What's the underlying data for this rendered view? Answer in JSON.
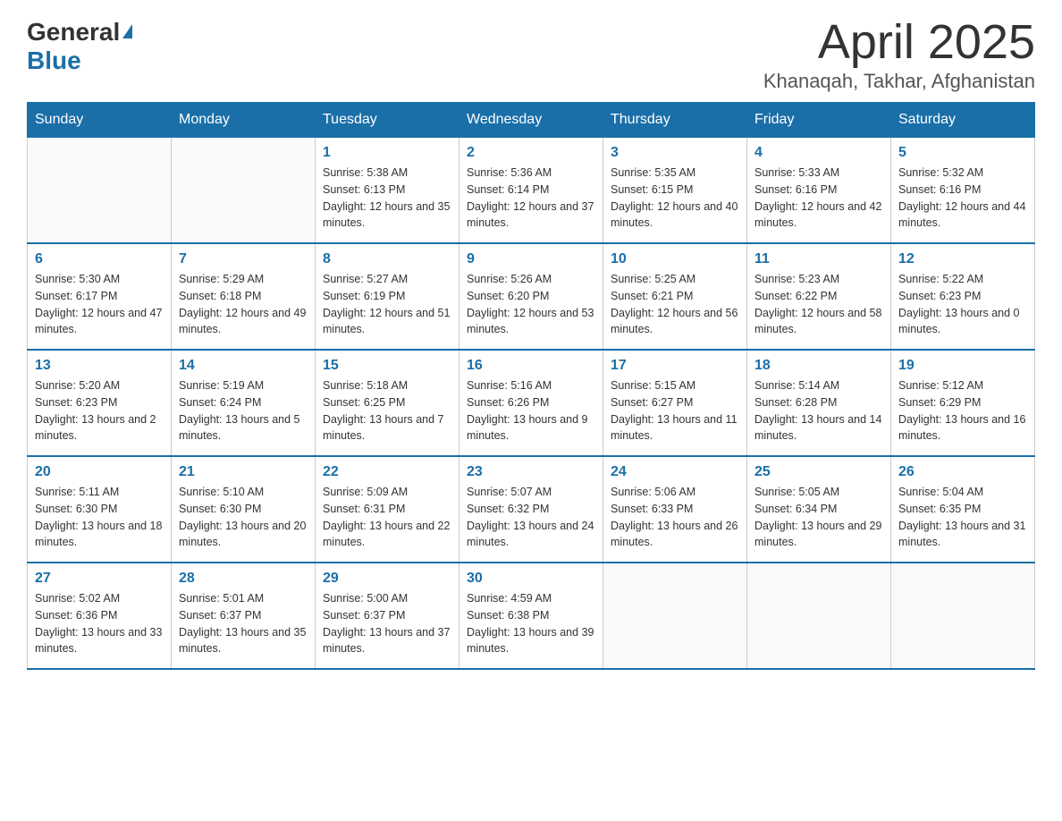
{
  "header": {
    "logo_general": "General",
    "logo_blue": "Blue",
    "title": "April 2025",
    "subtitle": "Khanaqah, Takhar, Afghanistan"
  },
  "days_of_week": [
    "Sunday",
    "Monday",
    "Tuesday",
    "Wednesday",
    "Thursday",
    "Friday",
    "Saturday"
  ],
  "weeks": [
    [
      {
        "day": "",
        "sunrise": "",
        "sunset": "",
        "daylight": ""
      },
      {
        "day": "",
        "sunrise": "",
        "sunset": "",
        "daylight": ""
      },
      {
        "day": "1",
        "sunrise": "Sunrise: 5:38 AM",
        "sunset": "Sunset: 6:13 PM",
        "daylight": "Daylight: 12 hours and 35 minutes."
      },
      {
        "day": "2",
        "sunrise": "Sunrise: 5:36 AM",
        "sunset": "Sunset: 6:14 PM",
        "daylight": "Daylight: 12 hours and 37 minutes."
      },
      {
        "day": "3",
        "sunrise": "Sunrise: 5:35 AM",
        "sunset": "Sunset: 6:15 PM",
        "daylight": "Daylight: 12 hours and 40 minutes."
      },
      {
        "day": "4",
        "sunrise": "Sunrise: 5:33 AM",
        "sunset": "Sunset: 6:16 PM",
        "daylight": "Daylight: 12 hours and 42 minutes."
      },
      {
        "day": "5",
        "sunrise": "Sunrise: 5:32 AM",
        "sunset": "Sunset: 6:16 PM",
        "daylight": "Daylight: 12 hours and 44 minutes."
      }
    ],
    [
      {
        "day": "6",
        "sunrise": "Sunrise: 5:30 AM",
        "sunset": "Sunset: 6:17 PM",
        "daylight": "Daylight: 12 hours and 47 minutes."
      },
      {
        "day": "7",
        "sunrise": "Sunrise: 5:29 AM",
        "sunset": "Sunset: 6:18 PM",
        "daylight": "Daylight: 12 hours and 49 minutes."
      },
      {
        "day": "8",
        "sunrise": "Sunrise: 5:27 AM",
        "sunset": "Sunset: 6:19 PM",
        "daylight": "Daylight: 12 hours and 51 minutes."
      },
      {
        "day": "9",
        "sunrise": "Sunrise: 5:26 AM",
        "sunset": "Sunset: 6:20 PM",
        "daylight": "Daylight: 12 hours and 53 minutes."
      },
      {
        "day": "10",
        "sunrise": "Sunrise: 5:25 AM",
        "sunset": "Sunset: 6:21 PM",
        "daylight": "Daylight: 12 hours and 56 minutes."
      },
      {
        "day": "11",
        "sunrise": "Sunrise: 5:23 AM",
        "sunset": "Sunset: 6:22 PM",
        "daylight": "Daylight: 12 hours and 58 minutes."
      },
      {
        "day": "12",
        "sunrise": "Sunrise: 5:22 AM",
        "sunset": "Sunset: 6:23 PM",
        "daylight": "Daylight: 13 hours and 0 minutes."
      }
    ],
    [
      {
        "day": "13",
        "sunrise": "Sunrise: 5:20 AM",
        "sunset": "Sunset: 6:23 PM",
        "daylight": "Daylight: 13 hours and 2 minutes."
      },
      {
        "day": "14",
        "sunrise": "Sunrise: 5:19 AM",
        "sunset": "Sunset: 6:24 PM",
        "daylight": "Daylight: 13 hours and 5 minutes."
      },
      {
        "day": "15",
        "sunrise": "Sunrise: 5:18 AM",
        "sunset": "Sunset: 6:25 PM",
        "daylight": "Daylight: 13 hours and 7 minutes."
      },
      {
        "day": "16",
        "sunrise": "Sunrise: 5:16 AM",
        "sunset": "Sunset: 6:26 PM",
        "daylight": "Daylight: 13 hours and 9 minutes."
      },
      {
        "day": "17",
        "sunrise": "Sunrise: 5:15 AM",
        "sunset": "Sunset: 6:27 PM",
        "daylight": "Daylight: 13 hours and 11 minutes."
      },
      {
        "day": "18",
        "sunrise": "Sunrise: 5:14 AM",
        "sunset": "Sunset: 6:28 PM",
        "daylight": "Daylight: 13 hours and 14 minutes."
      },
      {
        "day": "19",
        "sunrise": "Sunrise: 5:12 AM",
        "sunset": "Sunset: 6:29 PM",
        "daylight": "Daylight: 13 hours and 16 minutes."
      }
    ],
    [
      {
        "day": "20",
        "sunrise": "Sunrise: 5:11 AM",
        "sunset": "Sunset: 6:30 PM",
        "daylight": "Daylight: 13 hours and 18 minutes."
      },
      {
        "day": "21",
        "sunrise": "Sunrise: 5:10 AM",
        "sunset": "Sunset: 6:30 PM",
        "daylight": "Daylight: 13 hours and 20 minutes."
      },
      {
        "day": "22",
        "sunrise": "Sunrise: 5:09 AM",
        "sunset": "Sunset: 6:31 PM",
        "daylight": "Daylight: 13 hours and 22 minutes."
      },
      {
        "day": "23",
        "sunrise": "Sunrise: 5:07 AM",
        "sunset": "Sunset: 6:32 PM",
        "daylight": "Daylight: 13 hours and 24 minutes."
      },
      {
        "day": "24",
        "sunrise": "Sunrise: 5:06 AM",
        "sunset": "Sunset: 6:33 PM",
        "daylight": "Daylight: 13 hours and 26 minutes."
      },
      {
        "day": "25",
        "sunrise": "Sunrise: 5:05 AM",
        "sunset": "Sunset: 6:34 PM",
        "daylight": "Daylight: 13 hours and 29 minutes."
      },
      {
        "day": "26",
        "sunrise": "Sunrise: 5:04 AM",
        "sunset": "Sunset: 6:35 PM",
        "daylight": "Daylight: 13 hours and 31 minutes."
      }
    ],
    [
      {
        "day": "27",
        "sunrise": "Sunrise: 5:02 AM",
        "sunset": "Sunset: 6:36 PM",
        "daylight": "Daylight: 13 hours and 33 minutes."
      },
      {
        "day": "28",
        "sunrise": "Sunrise: 5:01 AM",
        "sunset": "Sunset: 6:37 PM",
        "daylight": "Daylight: 13 hours and 35 minutes."
      },
      {
        "day": "29",
        "sunrise": "Sunrise: 5:00 AM",
        "sunset": "Sunset: 6:37 PM",
        "daylight": "Daylight: 13 hours and 37 minutes."
      },
      {
        "day": "30",
        "sunrise": "Sunrise: 4:59 AM",
        "sunset": "Sunset: 6:38 PM",
        "daylight": "Daylight: 13 hours and 39 minutes."
      },
      {
        "day": "",
        "sunrise": "",
        "sunset": "",
        "daylight": ""
      },
      {
        "day": "",
        "sunrise": "",
        "sunset": "",
        "daylight": ""
      },
      {
        "day": "",
        "sunrise": "",
        "sunset": "",
        "daylight": ""
      }
    ]
  ]
}
